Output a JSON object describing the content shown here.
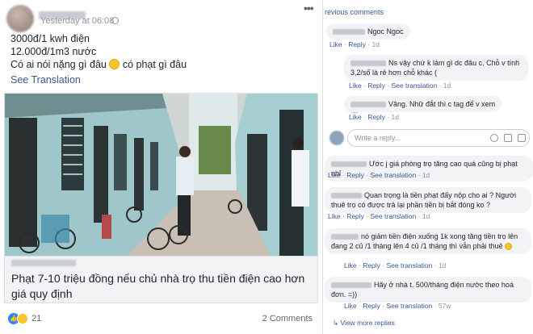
{
  "post": {
    "timestamp": "Yesterday at 06:08 ·",
    "more": "•••",
    "lines": [
      "3000đ/1 kwh điện",
      "12.000đ/1m3 nước",
      "Có ai nói nặng gì đâu",
      "có phạt gì đâu"
    ],
    "see_translation": "See Translation",
    "headline": "Phạt 7-10 triệu đồng nếu chủ nhà trọ thu tiền điện cao hơn giá quy định",
    "reaction_count": "21",
    "comments_count": "2 Comments"
  },
  "comments_panel": {
    "previous": "revious comments",
    "write_placeholder": "Write a reply...",
    "view_more": "View more replies",
    "comments": [
      {
        "text": "Ngoc Ngoc",
        "actions": [
          "Like",
          "Reply"
        ],
        "time": "1d"
      },
      {
        "text": "Ns vậy chứ k làm gì dc đâu c. Chỗ v tính 3,2/số là rẻ hơn chỗ khác (",
        "actions": [
          "Like",
          "Reply",
          "See translation"
        ],
        "time": "1d"
      },
      {
        "text": "Vâng. Nhữ đắt thì c tag để v xem",
        "actions": [
          "Like",
          "Reply"
        ],
        "time": "1d"
      },
      {
        "text": "Ước j giá phòng trọ tăng cao quá cũng bị phạt nhỉ",
        "actions": [
          "Like",
          "Reply",
          "See translation"
        ],
        "time": "1d"
      },
      {
        "text": "Quan trọng là tiền phạt đấy nộp cho ai ? Người thuê trọ có được trả lại phần tiền bị bắt đóng ko ?",
        "actions": [
          "Like",
          "Reply",
          "See translation"
        ],
        "time": "1d"
      },
      {
        "text": "nó giảm tiền điện xuống 1k xong tăng tiền trọ lên đang 2 củ /1 tháng lên 4 củ /1 tháng thì vẫn phải thuê",
        "actions": [
          "Like",
          "Reply",
          "See translation"
        ],
        "time": "1d"
      },
      {
        "text": "Hãy ở nhà t. 500/tháng điện nước theo hoá đơn. =))",
        "actions": [
          "Like",
          "Reply",
          "See translation"
        ],
        "time": "57w"
      }
    ]
  }
}
